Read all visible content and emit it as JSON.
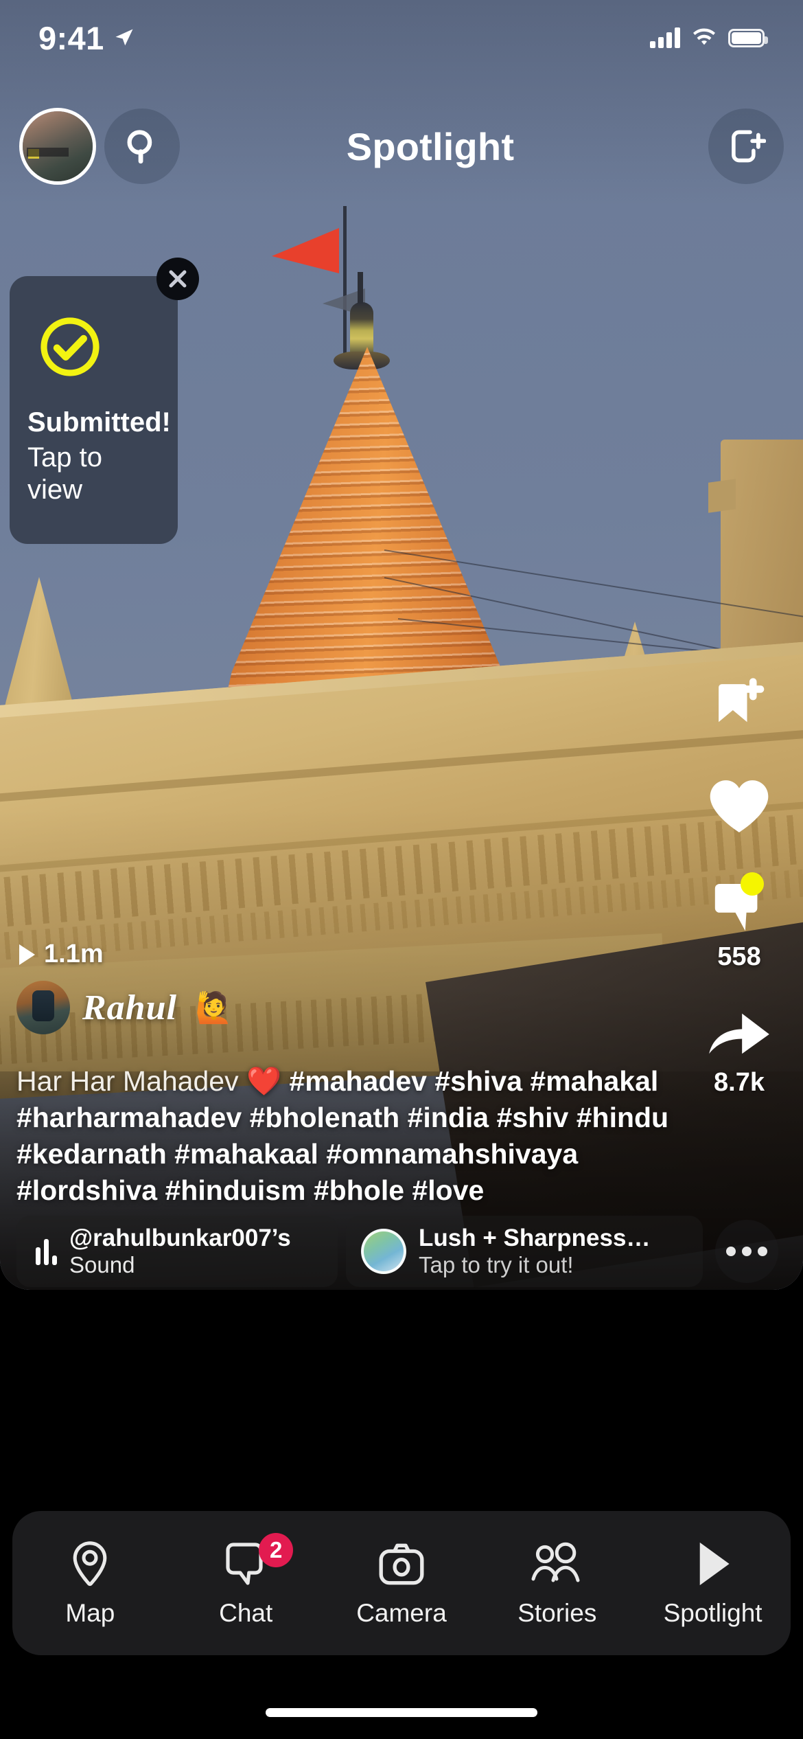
{
  "status_bar": {
    "time": "9:41",
    "location_icon": "location-arrow-icon",
    "cellular_icon": "cellular-bars-icon",
    "wifi_icon": "wifi-icon",
    "battery_icon": "battery-full-icon"
  },
  "header": {
    "title": "Spotlight",
    "avatar_icon": "profile-avatar",
    "search_icon": "search-icon",
    "add_friend_icon": "add-friend-icon"
  },
  "submitted_card": {
    "check_icon": "check-circle-icon",
    "title": "Submitted!",
    "subtitle": "Tap to view",
    "close_icon": "close-icon",
    "accent_color": "#f2f312"
  },
  "video": {
    "views_count": "1.1m",
    "play_icon": "play-icon",
    "author_name": "Rahul",
    "author_emoji": "🙋",
    "author_avatar": "author-avatar",
    "caption_plain": "Har Har Mahadev ",
    "caption_emoji": "❤️",
    "caption_tags": " #mahadev #shiva #mahakal #harharmahadev #bholenath #india #shiv #hindu #kedarnath #mahakaal #omnamahshivaya #lordshiva #hinduism #bhole #love"
  },
  "action_rail": [
    {
      "name": "save-story-button",
      "icon": "bookmark-plus-icon",
      "count": ""
    },
    {
      "name": "like-button",
      "icon": "heart-icon",
      "count": ""
    },
    {
      "name": "comment-button",
      "icon": "comment-icon",
      "count": "558",
      "badge": true
    },
    {
      "name": "share-button",
      "icon": "share-arrow-icon",
      "count": "8.7k"
    }
  ],
  "chips": {
    "sound": {
      "icon": "audio-waveform-icon",
      "line1": "@rahulbunkar007’s",
      "line2": "Sound"
    },
    "lens": {
      "thumb_icon": "lens-thumbnail",
      "line1": "Lush + Sharpness…",
      "line2": "Tap to try it out!"
    },
    "more_icon": "more-options-icon"
  },
  "tabbar": {
    "items": [
      {
        "label": "Map",
        "icon": "map-pin-icon",
        "badge": ""
      },
      {
        "label": "Chat",
        "icon": "chat-icon",
        "badge": "2"
      },
      {
        "label": "Camera",
        "icon": "camera-icon",
        "badge": ""
      },
      {
        "label": "Stories",
        "icon": "stories-icon",
        "badge": ""
      },
      {
        "label": "Spotlight",
        "icon": "play-solid-icon",
        "badge": ""
      }
    ],
    "badge_color": "#e21b50"
  },
  "home_indicator": "home-indicator"
}
